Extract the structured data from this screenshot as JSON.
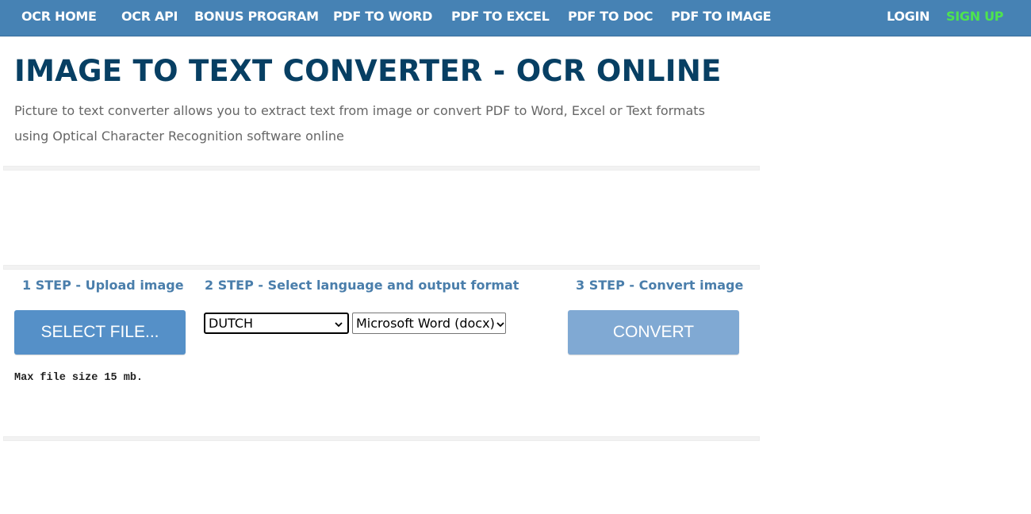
{
  "nav": {
    "items": [
      {
        "label": "OCR HOME"
      },
      {
        "label": "OCR API"
      },
      {
        "label": "BONUS PROGRAM"
      },
      {
        "label": "PDF TO WORD"
      },
      {
        "label": "PDF TO EXCEL"
      },
      {
        "label": "PDF TO DOC"
      },
      {
        "label": "PDF TO IMAGE"
      }
    ],
    "login": "LOGIN",
    "signup": "SIGN UP"
  },
  "header": {
    "title": "IMAGE TO TEXT CONVERTER - OCR ONLINE",
    "subtitle": "Picture to text converter allows you to extract text from image or convert PDF to Word, Excel or Text formats using Optical Character Recognition software online"
  },
  "steps": {
    "step1": {
      "label": "1 STEP - Upload image",
      "button": "SELECT FILE...",
      "note": "Max file size 15 mb."
    },
    "step2": {
      "label": "2 STEP - Select language and output format",
      "language": "DUTCH",
      "format": "Microsoft Word (docx)"
    },
    "step3": {
      "label": "3 STEP - Convert image",
      "button": "CONVERT"
    }
  },
  "colors": {
    "nav_bg": "#4682b4",
    "signup": "#4ee44e",
    "title": "#073f63",
    "step_label": "#4a7eab",
    "select_button": "#5590c8",
    "convert_button": "#80a9d3"
  }
}
